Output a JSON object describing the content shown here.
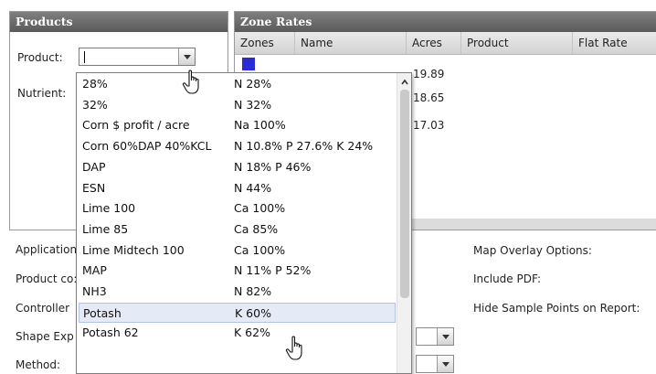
{
  "products_panel": {
    "title": "Products",
    "product_label": "Product:",
    "product_value": "",
    "nutrient_label": "Nutrient:"
  },
  "zone_panel": {
    "title": "Zone Rates",
    "columns": [
      "Zones",
      "Name",
      "Acres",
      "Product",
      "Flat Rate"
    ],
    "acres": [
      "19.89",
      "18.65",
      "17.03"
    ]
  },
  "lower_form": {
    "application_label": "Application",
    "product_cost_label": "Product co:",
    "controller_label": "Controller",
    "shape_export_label": "Shape Exp",
    "method_label": "Method:",
    "map_overlay_label": "Map Overlay Options:",
    "include_pdf_label": "Include PDF:",
    "hide_sample_points_label": "Hide Sample Points on Report:"
  },
  "dropdown": {
    "items": [
      {
        "name": "28%",
        "nutrient": "N 28%"
      },
      {
        "name": "32%",
        "nutrient": "N 32%"
      },
      {
        "name": "Corn $ profit / acre",
        "nutrient": "Na 100%"
      },
      {
        "name": "Corn 60%DAP 40%KCL",
        "nutrient": "N 10.8% P 27.6% K 24%"
      },
      {
        "name": "DAP",
        "nutrient": "N 18% P 46%"
      },
      {
        "name": "ESN",
        "nutrient": "N 44%"
      },
      {
        "name": "Lime 100",
        "nutrient": "Ca 100%"
      },
      {
        "name": "Lime 85",
        "nutrient": "Ca 85%"
      },
      {
        "name": "Lime Midtech 100",
        "nutrient": "Ca 100%"
      },
      {
        "name": "MAP",
        "nutrient": "N 11% P 52%"
      },
      {
        "name": "NH3",
        "nutrient": "N 82%"
      },
      {
        "name": "Potash",
        "nutrient": "K 60%"
      },
      {
        "name": "Potash 62",
        "nutrient": "K 62%"
      }
    ],
    "selected_index": 11
  },
  "colors": {
    "header_bg": "#6b6b6b",
    "zone_swatch": "#2b2bd6",
    "selected_row": "#e4ebf6"
  }
}
